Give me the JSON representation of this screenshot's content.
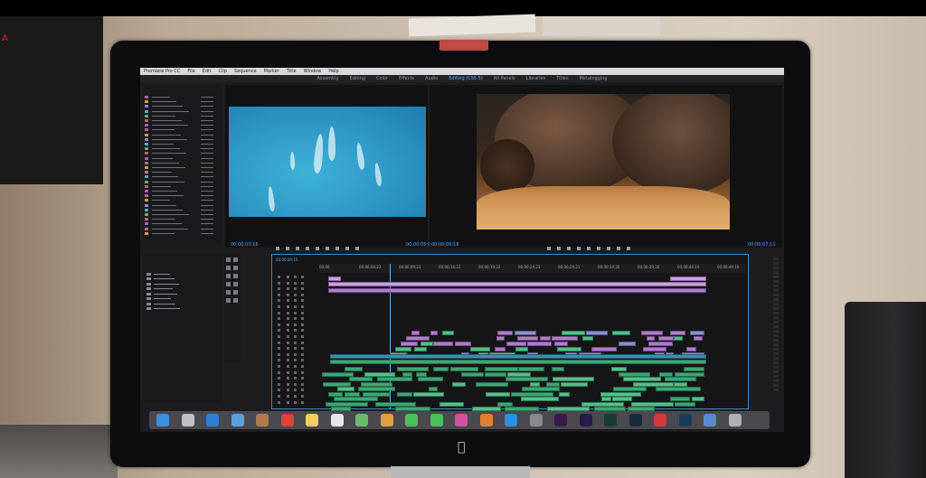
{
  "scene": {
    "description_labels": [],
    "poster_text": "A"
  },
  "menubar": [
    "Premiere Pro CC",
    "File",
    "Edit",
    "Clip",
    "Sequence",
    "Marker",
    "Title",
    "Window",
    "Help"
  ],
  "workspace": {
    "tabs": [
      "Assembly",
      "Editing",
      "Color",
      "Effects",
      "Audio",
      "Editing (CS5.5)",
      "All Panels",
      "Libraries",
      "Titles",
      "Metalogging"
    ],
    "active_index": 5
  },
  "timecodes": {
    "source_left": "00;00;03;16",
    "source_right": "00;00;05;02",
    "program_left": "00;00;09;16",
    "program_right": "00;00;07;11"
  },
  "timeline": {
    "ruler": [
      "00;00",
      "00;00;04;23",
      "00;00;09;23",
      "00;00;14;22",
      "00;00;19;22",
      "00;00;24;21",
      "00;00;29;21",
      "00;00;34;20",
      "00;00;39;20",
      "00;00;44;19",
      "00;00;49;19"
    ],
    "sequence_time": "00;00;09;15"
  },
  "colors": {
    "video_clip": "#b27ad0",
    "video_clip_light": "#cf9de6",
    "audio_clip": "#3ca874",
    "audio_clip_alt": "#54c08a",
    "accent": "#4fa9ff"
  },
  "dock_icons": [
    "finder",
    "launchpad",
    "safari",
    "mail",
    "contacts",
    "calendar",
    "notes",
    "reminders",
    "maps",
    "photos",
    "messages",
    "facetime",
    "itunes",
    "ibooks",
    "app-store",
    "system-prefs",
    "premiere",
    "after-effects",
    "speedgrade",
    "lightroom",
    "creative-cloud",
    "photoshop",
    "folder",
    "trash"
  ]
}
